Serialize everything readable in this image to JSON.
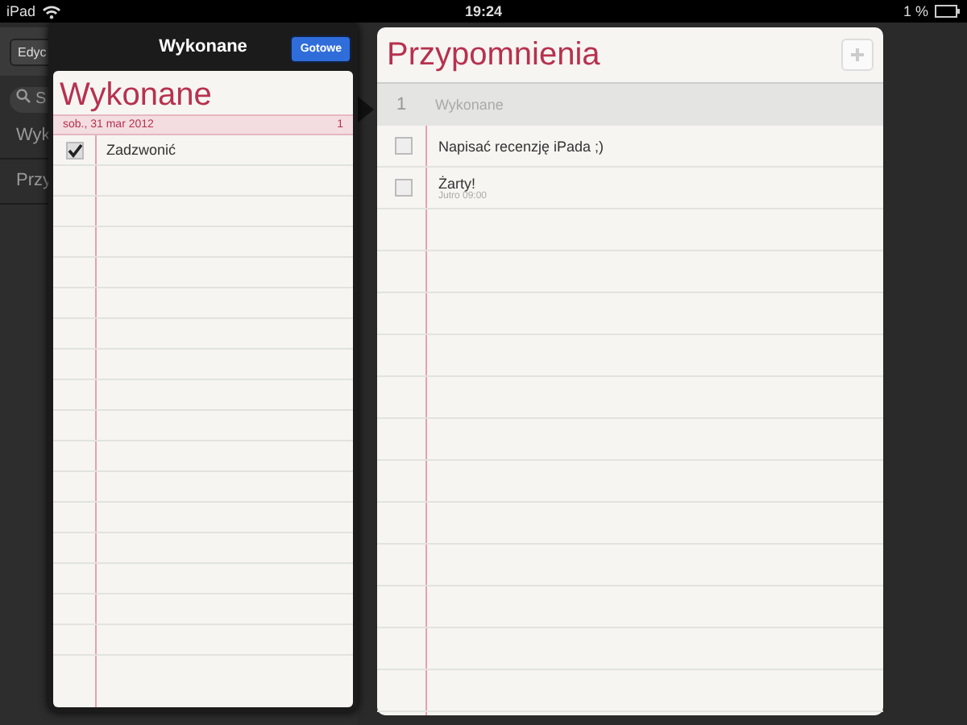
{
  "status_bar": {
    "device": "iPad",
    "time": "19:24",
    "battery": "1 %"
  },
  "sidebar": {
    "edit_button": "Edyc",
    "search": {
      "placeholder": "S"
    },
    "items": [
      {
        "label": "Wyk"
      },
      {
        "label": "Przy"
      }
    ]
  },
  "popover": {
    "title": "Wykonane",
    "done_button": "Gotowe",
    "list_title": "Wykonane",
    "date_header": {
      "date": "sob., 31 mar 2012",
      "count": "1"
    },
    "items": [
      {
        "title": "Zadzwonić",
        "checked": true
      }
    ]
  },
  "list": {
    "title": "Przypomnienia",
    "completed_row": {
      "count": "1",
      "label": "Wykonane"
    },
    "items": [
      {
        "title": "Napisać recenzję iPada ;)",
        "checked": false
      },
      {
        "title": "Żarty!",
        "due": "Jutro 09:00",
        "checked": false
      }
    ]
  }
}
